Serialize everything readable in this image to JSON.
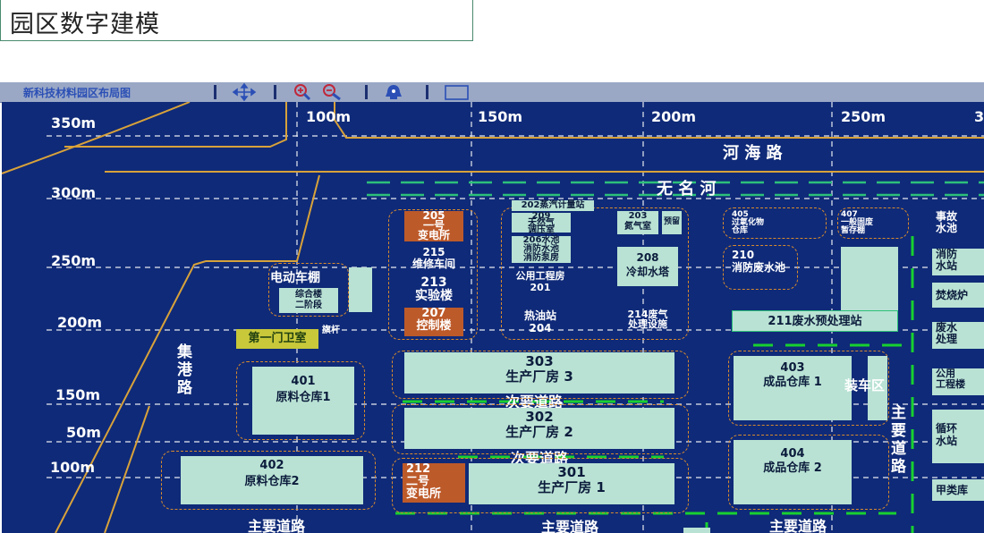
{
  "page_title": "园区数字建模",
  "toolbar": {
    "title": "新科技材料园区布局图",
    "icons": [
      "move-icon",
      "zoom-in-icon",
      "zoom-out-icon",
      "locate-icon",
      "rectangle-select-icon"
    ]
  },
  "map": {
    "x_ticks": [
      "100m",
      "150m",
      "200m",
      "250m",
      "3"
    ],
    "y_ticks": [
      "350m",
      "300m",
      "250m",
      "200m",
      "150m",
      "50m",
      "100m"
    ],
    "roads": {
      "river_road": "河 海 路",
      "river": "无 名 河",
      "port_road": "集港路",
      "secondary_1": "次要道路",
      "secondary_2": "次要道路",
      "main_1": "主要道路",
      "main_2": "主要道路",
      "main_3": "主要道路",
      "main_vertical": "主要道路"
    },
    "buildings": {
      "b205": "205\n一号\n变电所",
      "b215": "215\n维修车间",
      "b213": "213\n实验楼",
      "b207": "207\n控制楼",
      "b202": "202蒸汽计量站",
      "b209": "209\n天然气\n调压室",
      "b206": "206水池\n消防水池\n消防泵房",
      "b201": "公用工程房\n201",
      "b204": "热油站\n204",
      "b203": "203\n氮气室",
      "b203b": "预留",
      "b208": "208\n冷却水塔",
      "b214": "214废气\n处理设施",
      "b405": "405\n过氧化物\n仓库",
      "b407": "407\n一般固废\n暂存棚",
      "b210": "210\n消防废水池",
      "b211": "211废水预处理站",
      "ev_shed": "电动车棚",
      "complex": "综合楼\n二阶段",
      "gate": "第一门卫室",
      "flag": "旗杆",
      "b401": "401\n原料仓库1",
      "b402": "402\n原料仓库2",
      "b303": "303\n生产厂房 3",
      "b302": "302\n生产厂房 2",
      "b301": "301\n生产厂房 1",
      "b212": "212\n二号\n变电所",
      "b403": "403\n成品仓库 1",
      "loading": "装车区",
      "b404": "404\n成品仓库 2",
      "accident_pool": "事故\n水池",
      "fire_station": "消防\n水站",
      "incinerator": "焚烧炉",
      "waste_water": "废水\n处理",
      "utility": "公用\n工程楼",
      "circulating": "循环\n水站",
      "class_a": "甲类库"
    }
  },
  "colors": {
    "map_bg": "#0f2a78",
    "building": "#b9e2d4",
    "substation": "#bd5a2a",
    "boundary": "#d88a2e",
    "road_line": "#d8a23a",
    "river_dash": "#2dc07a",
    "green_dash": "#18d030",
    "toolbar": "#9aa8c6"
  }
}
